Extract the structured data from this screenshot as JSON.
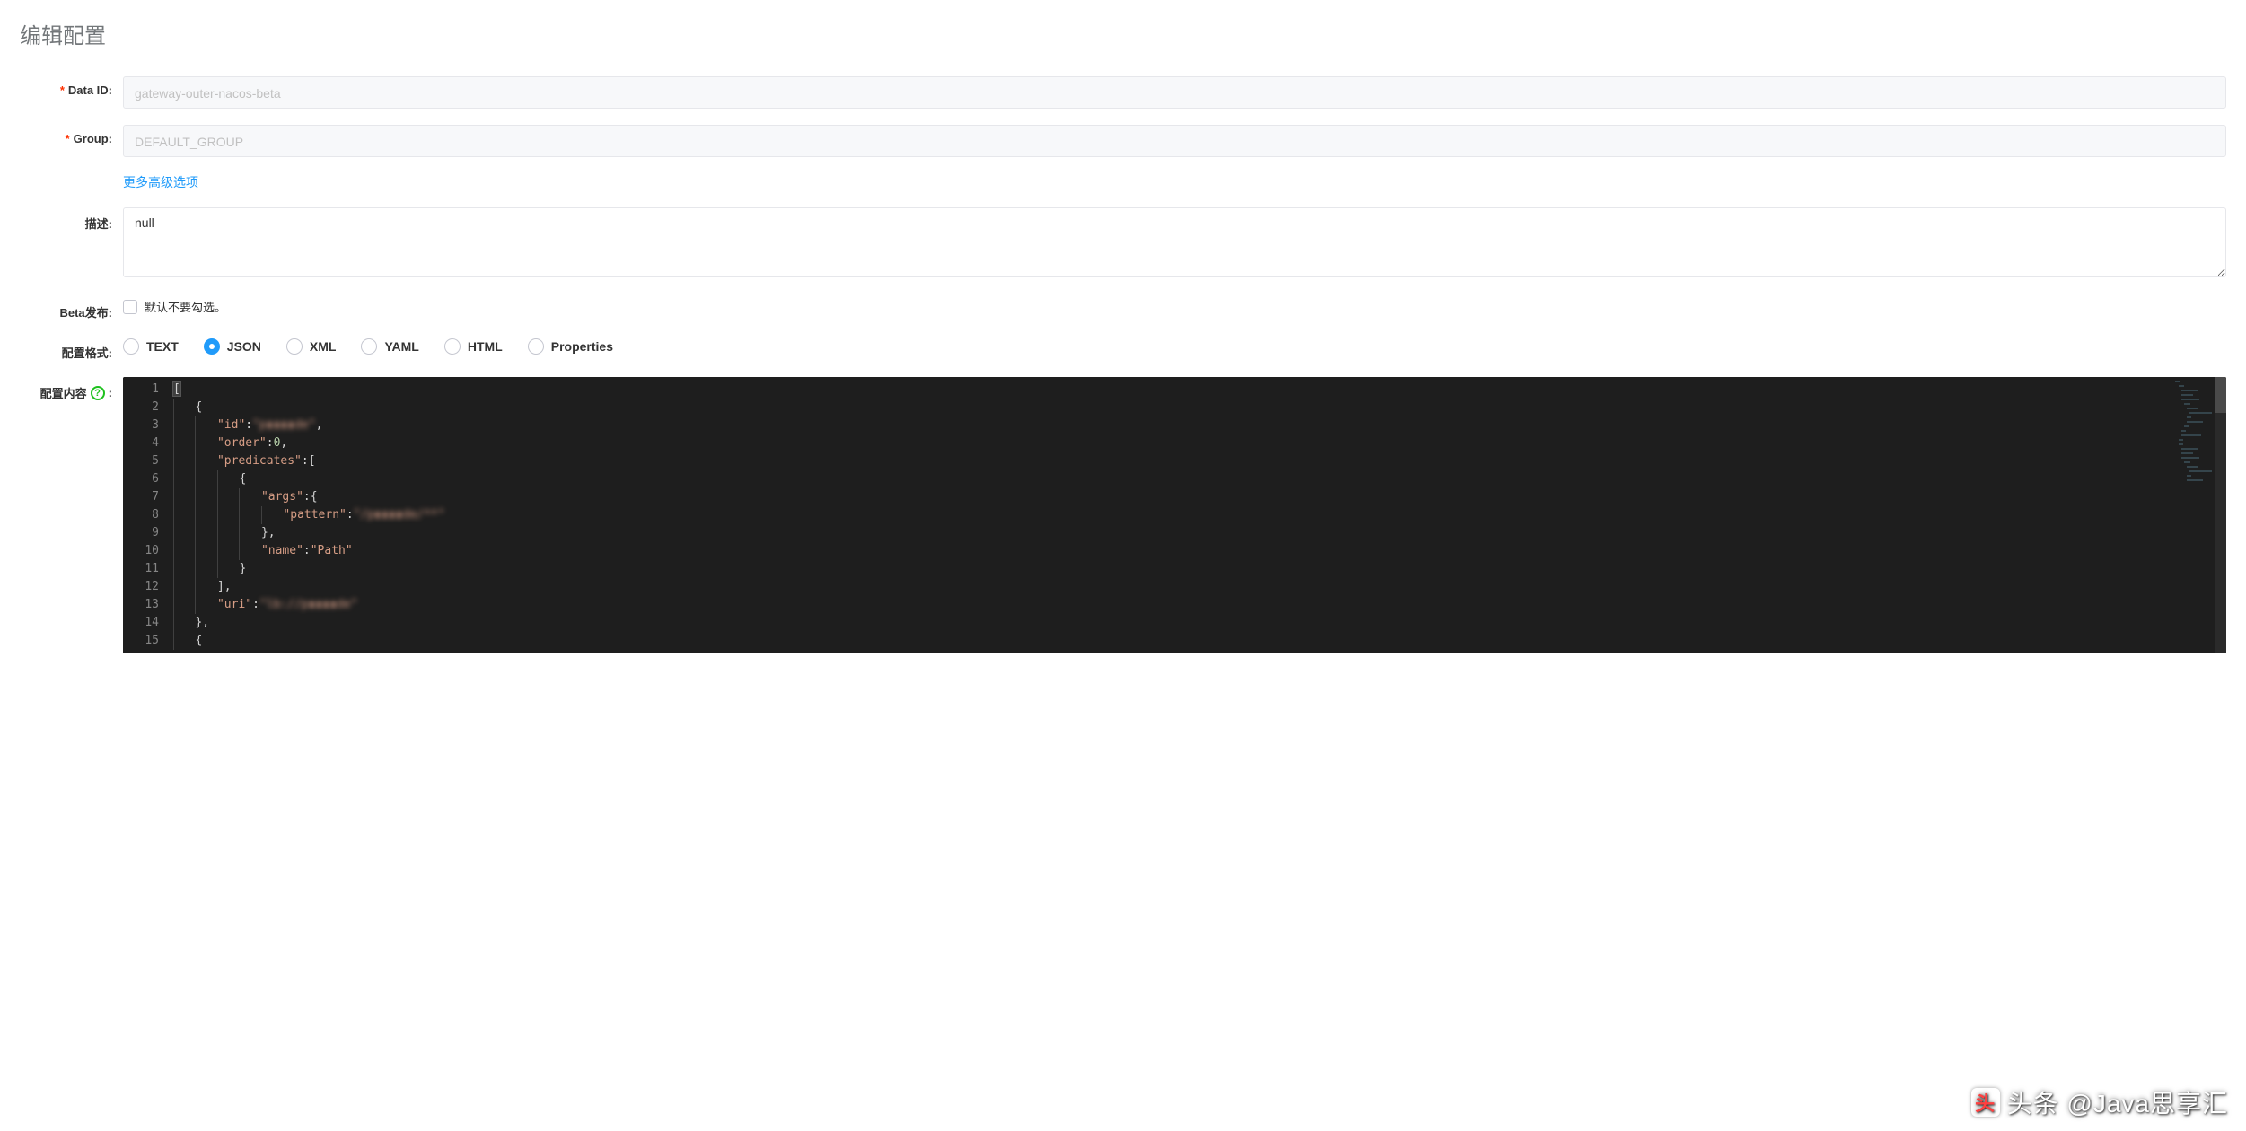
{
  "page": {
    "title": "编辑配置"
  },
  "form": {
    "data_id": {
      "label": "Data ID:",
      "value": "gateway-outer-nacos-beta"
    },
    "group": {
      "label": "Group:",
      "value": "DEFAULT_GROUP"
    },
    "advanced_link": "更多高级选项",
    "description": {
      "label": "描述:",
      "value": "null"
    },
    "beta_publish": {
      "label": "Beta发布:",
      "hint": "默认不要勾选。",
      "checked": false
    },
    "config_format": {
      "label": "配置格式:",
      "options": [
        {
          "value": "TEXT",
          "label": "TEXT"
        },
        {
          "value": "JSON",
          "label": "JSON"
        },
        {
          "value": "XML",
          "label": "XML"
        },
        {
          "value": "YAML",
          "label": "YAML"
        },
        {
          "value": "HTML",
          "label": "HTML"
        },
        {
          "value": "Properties",
          "label": "Properties"
        }
      ],
      "selected": "JSON"
    },
    "config_content": {
      "label": "配置内容",
      "colon": ":",
      "help_icon": "?",
      "lines": [
        {
          "n": 1,
          "indent": 0,
          "pre": "",
          "text": "[",
          "cursor": true
        },
        {
          "n": 2,
          "indent": 1,
          "pre": "",
          "text": "{"
        },
        {
          "n": 3,
          "indent": 2,
          "key": "\"id\"",
          "mid": ":",
          "val": "\"p▮▮▮▮de\"",
          "tail": ",",
          "blur_val": true
        },
        {
          "n": 4,
          "indent": 2,
          "key": "\"order\"",
          "mid": ":",
          "num": "0",
          "tail": ","
        },
        {
          "n": 5,
          "indent": 2,
          "key": "\"predicates\"",
          "mid": ":["
        },
        {
          "n": 6,
          "indent": 3,
          "pre": "",
          "text": "{"
        },
        {
          "n": 7,
          "indent": 4,
          "key": "\"args\"",
          "mid": ":{"
        },
        {
          "n": 8,
          "indent": 5,
          "key": "\"pattern\"",
          "mid": ":",
          "val": "\"/p▮▮▮▮de/**\"",
          "blur_val": true
        },
        {
          "n": 9,
          "indent": 4,
          "pre": "",
          "text": "},"
        },
        {
          "n": 10,
          "indent": 4,
          "key": "\"name\"",
          "mid": ":",
          "val": "\"Path\""
        },
        {
          "n": 11,
          "indent": 3,
          "pre": "",
          "text": "}"
        },
        {
          "n": 12,
          "indent": 2,
          "pre": "",
          "text": "],"
        },
        {
          "n": 13,
          "indent": 2,
          "key": "\"uri\"",
          "mid": ":",
          "val": "\"lb://p▮▮▮▮de\"",
          "blur_val": true
        },
        {
          "n": 14,
          "indent": 1,
          "pre": "",
          "text": "},"
        },
        {
          "n": 15,
          "indent": 1,
          "pre": "",
          "text": "{"
        }
      ]
    }
  },
  "watermark": {
    "logo_text": "头",
    "text": "头条 @Java思享汇"
  }
}
